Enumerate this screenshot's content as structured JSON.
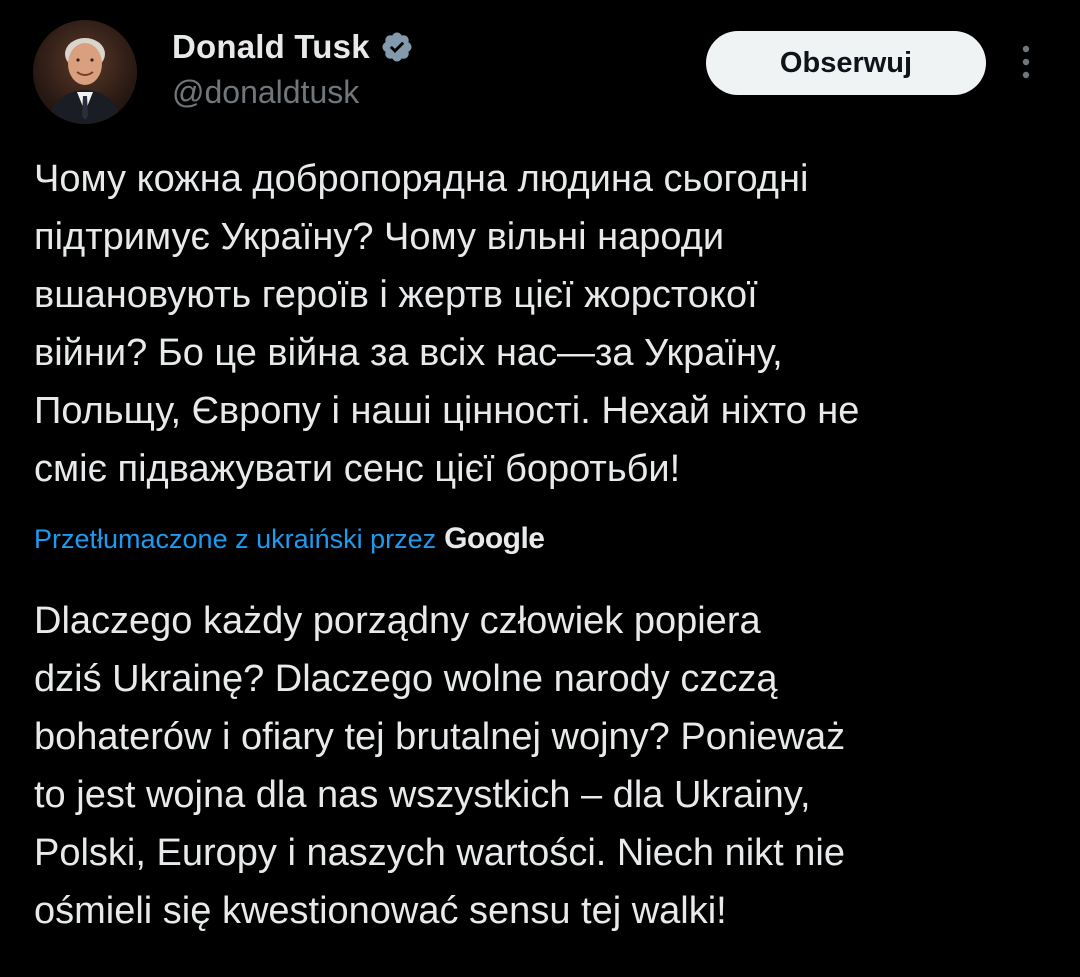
{
  "author": {
    "display_name": "Donald Tusk",
    "handle": "@donaldtusk",
    "verified": true,
    "avatar_icon": "person-portrait-avatar"
  },
  "actions": {
    "follow_label": "Obserwuj",
    "more_icon": "vertical-ellipsis-icon"
  },
  "tweet": {
    "original_text": "Чому кожна добропорядна людина сьогодні\nпідтримує Україну? Чому вільні народи\nвшановують героїв і жертв цієї жорстокої\nвійни? Бо це війна за всіх нас—за Україну,\nПольщу, Європу і наші цінності. Нехай ніхто не\nсміє підважувати сенс цієї боротьби!",
    "translation_label": "Przetłumaczone z ukraiński przez",
    "translation_provider": "Google",
    "translated_text": "Dlaczego każdy porządny człowiek popiera\ndziś Ukrainę? Dlaczego wolne narody czczą\nbohaterów i ofiary tej brutalnej wojny? Ponieważ\nto jest wojna dla nas wszystkich – dla Ukrainy,\nPolski, Europy i naszych wartości. Niech nikt nie\nośmieli się kwestionować sensu tej walki!"
  },
  "colors": {
    "background": "#000000",
    "text_primary": "#e7e9ea",
    "text_secondary": "#71767b",
    "link": "#1d9bf0",
    "verified_badge": "#829aab",
    "follow_button_bg": "#eff3f4"
  }
}
